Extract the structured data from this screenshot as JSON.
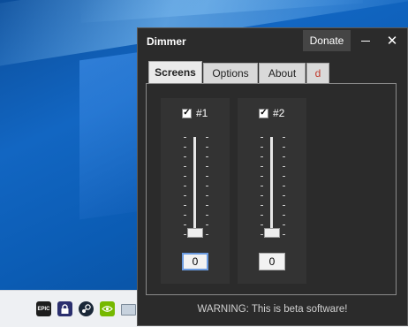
{
  "window": {
    "title": "Dimmer",
    "donate_label": "Donate",
    "close_glyph": "✕"
  },
  "tabs": [
    {
      "label": "Screens",
      "active": true
    },
    {
      "label": "Options",
      "active": false
    },
    {
      "label": "About",
      "active": false
    },
    {
      "label": "d",
      "active": false
    }
  ],
  "screens": [
    {
      "label": "#1",
      "checked": true,
      "value": "0",
      "focused": true
    },
    {
      "label": "#2",
      "checked": true,
      "value": "0",
      "focused": false
    }
  ],
  "warning": "WARNING: This is beta software!",
  "taskbar": {
    "tray_icons": [
      "epic-games-icon",
      "password-manager-icon",
      "steam-icon",
      "nvidia-icon",
      "display-icon"
    ],
    "epic_text": "EPIC"
  },
  "colors": {
    "window_bg": "#2b2b2b",
    "tab_d_color": "#c0392b",
    "focus_border": "#6b9be0"
  }
}
